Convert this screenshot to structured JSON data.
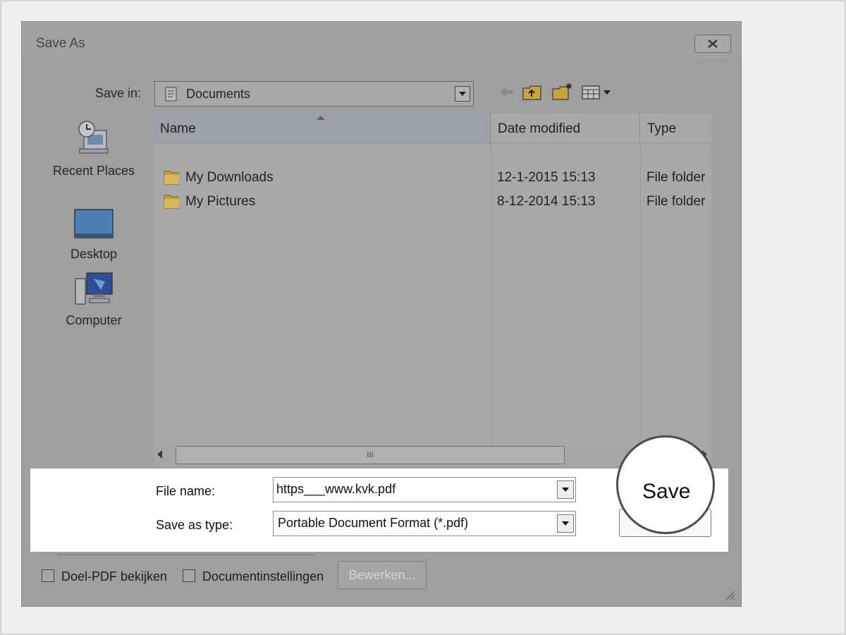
{
  "window": {
    "title": "Save As"
  },
  "save_in": {
    "label": "Save in:",
    "value": "Documents"
  },
  "places": [
    {
      "label": "Recent Places",
      "icon": "recent-places-icon"
    },
    {
      "label": "Desktop",
      "icon": "desktop-icon"
    },
    {
      "label": "Computer",
      "icon": "computer-icon"
    }
  ],
  "file_list": {
    "columns": [
      "Name",
      "Date modified",
      "Type"
    ],
    "rows": [
      {
        "name": "My Downloads",
        "date": "12-1-2015 15:13",
        "type": "File folder"
      },
      {
        "name": "My Pictures",
        "date": "8-12-2014 15:13",
        "type": "File folder"
      }
    ],
    "scroll_thumb_glyph": "III"
  },
  "file_name": {
    "label": "File name:",
    "value": "https___www.kvk.pdf"
  },
  "save_as_type": {
    "label": "Save as type:",
    "value": "Portable Document Format (*.pdf)"
  },
  "buttons": {
    "save": "Save",
    "edit": "Bewerken..."
  },
  "options": [
    {
      "label": "Doel-PDF bekijken",
      "checked": false
    },
    {
      "label": "Documentinstellingen",
      "checked": false
    }
  ],
  "colors": {
    "dialog_overlay": "#9f9f9f",
    "highlight_panel": "#ffffff",
    "folder": "#caa23c"
  }
}
